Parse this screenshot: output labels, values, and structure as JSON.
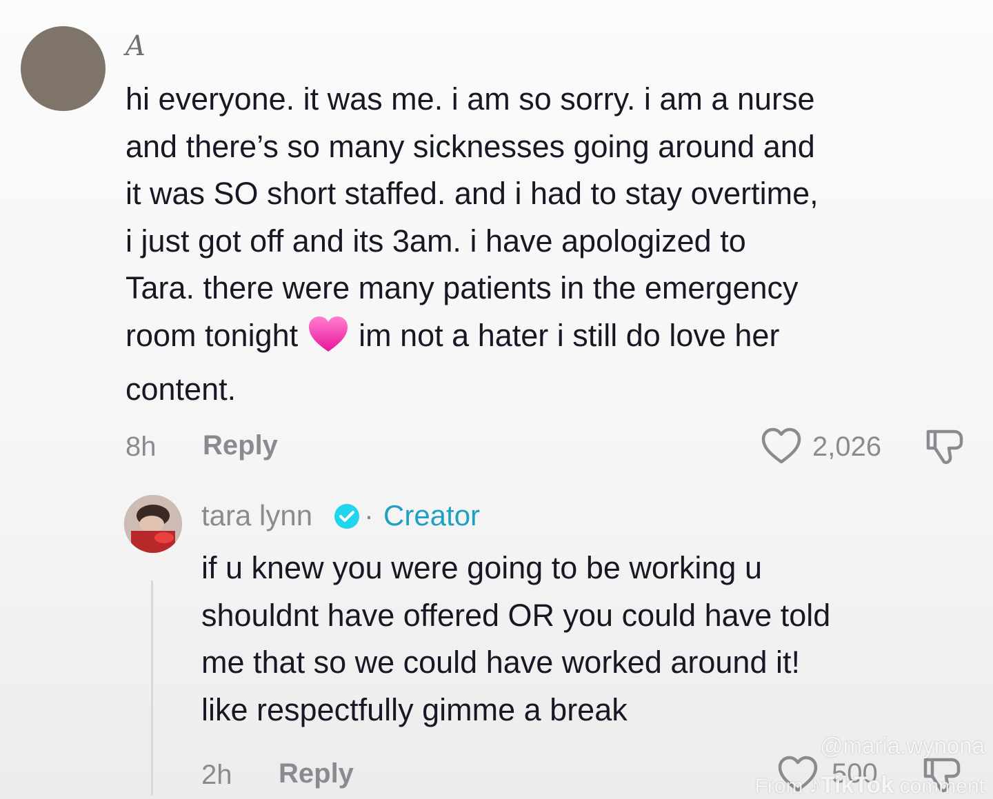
{
  "comment": {
    "username": "A",
    "lines": [
      "hi everyone. it was me. i am so sorry. i am a nurse",
      "and there’s so many sicknesses going around and",
      "it was SO short staffed. and i had to stay overtime,",
      "i just got off and its 3am. i have apologized to",
      "Tara. there were many patients in the emergency"
    ],
    "line6_before": "room tonight",
    "line6_after": "im not a hater i still do love her",
    "line7": "content.",
    "emoji": "pink-heart",
    "time": "8h",
    "reply_label": "Reply",
    "likes": "2,026"
  },
  "reply": {
    "username": "tara lynn",
    "separator": "·",
    "creator_label": "Creator",
    "lines": [
      "if u knew you were going to be working u",
      "shouldnt have offered OR you could have told",
      "me that so we could have worked around it!",
      "like respectfully gimme a break"
    ],
    "time": "2h",
    "reply_label": "Reply",
    "likes": "500"
  },
  "watermark": {
    "handle": "@maria.wynona",
    "from": "From",
    "brand": "TikTok",
    "suffix": "comment"
  },
  "colors": {
    "text": "#161823",
    "muted": "#8a8b91",
    "creator": "#20a0c0",
    "verified": "#20d5ec",
    "emoji": "#ff4fb4"
  }
}
